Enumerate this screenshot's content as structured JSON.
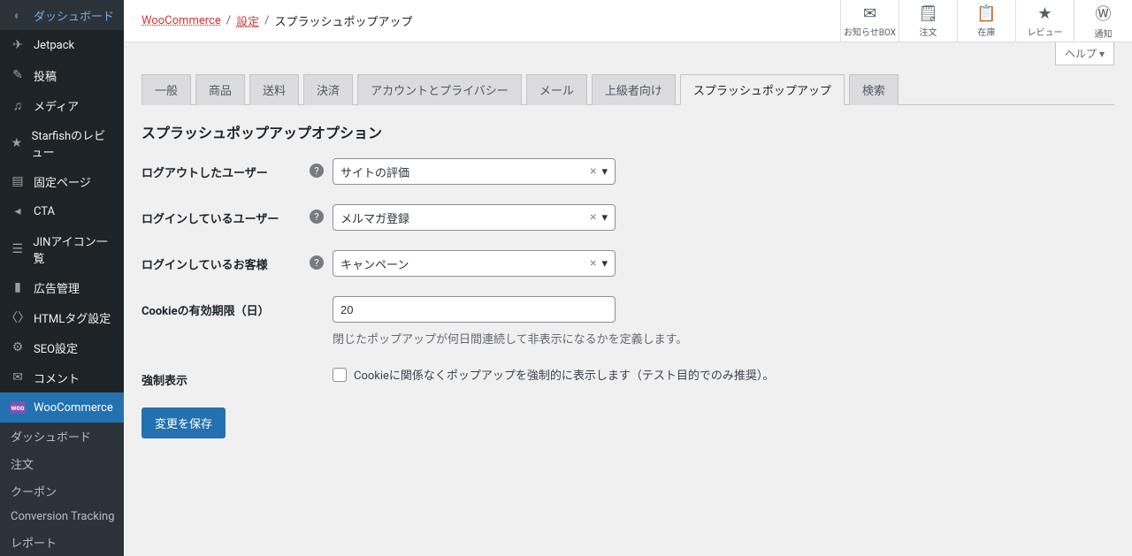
{
  "sidebar": {
    "items": [
      {
        "icon": "◐",
        "label": "ダッシュボード"
      },
      {
        "icon": "✈",
        "label": "Jetpack"
      },
      {
        "icon": "✎",
        "label": "投稿"
      },
      {
        "icon": "♫",
        "label": "メディア"
      },
      {
        "icon": "★",
        "label": "Starfishのレビュー"
      },
      {
        "icon": "▤",
        "label": "固定ページ"
      },
      {
        "icon": "◂",
        "label": "CTA"
      },
      {
        "icon": "☰",
        "label": "JINアイコン一覧"
      },
      {
        "icon": "▮",
        "label": "広告管理"
      },
      {
        "icon": "〈〉",
        "label": "HTMLタグ設定"
      },
      {
        "icon": "⚙",
        "label": "SEO設定"
      },
      {
        "icon": "✉",
        "label": "コメント"
      }
    ],
    "current": {
      "label": "WooCommerce"
    },
    "submenu": [
      "ダッシュボード",
      "注文",
      "クーポン",
      "Conversion Tracking",
      "レポート"
    ]
  },
  "breadcrumb": {
    "a": "WooCommerce",
    "b": "設定",
    "c": "スプラッシュポップアップ"
  },
  "topIcons": [
    {
      "icon": "✉",
      "label": "お知らせBOX"
    },
    {
      "icon": "🗒",
      "label": "注文"
    },
    {
      "icon": "📋",
      "label": "在庫"
    },
    {
      "icon": "★",
      "label": "レビュー"
    },
    {
      "icon": "Ⓦ",
      "label": "通知"
    }
  ],
  "help": "ヘルプ ▾",
  "tabs": [
    "一般",
    "商品",
    "送料",
    "決済",
    "アカウントとプライバシー",
    "メール",
    "上級者向け",
    "スプラッシュポップアップ",
    "検索"
  ],
  "activeTab": "スプラッシュポップアップ",
  "section": "スプラッシュポップアップオプション",
  "fields": {
    "loggedOut": {
      "label": "ログアウトしたユーザー",
      "value": "サイトの評価"
    },
    "loggedIn": {
      "label": "ログインしているユーザー",
      "value": "メルマガ登録"
    },
    "customer": {
      "label": "ログインしているお客様",
      "value": "キャンペーン"
    },
    "cookie": {
      "label": "Cookieの有効期限（日）",
      "value": "20",
      "desc": "閉じたポップアップが何日間連続して非表示になるかを定義します。"
    },
    "force": {
      "label": "強制表示",
      "desc": "Cookieに関係なくポップアップを強制的に表示します（テスト目的でのみ推奨）。"
    }
  },
  "submit": "変更を保存"
}
